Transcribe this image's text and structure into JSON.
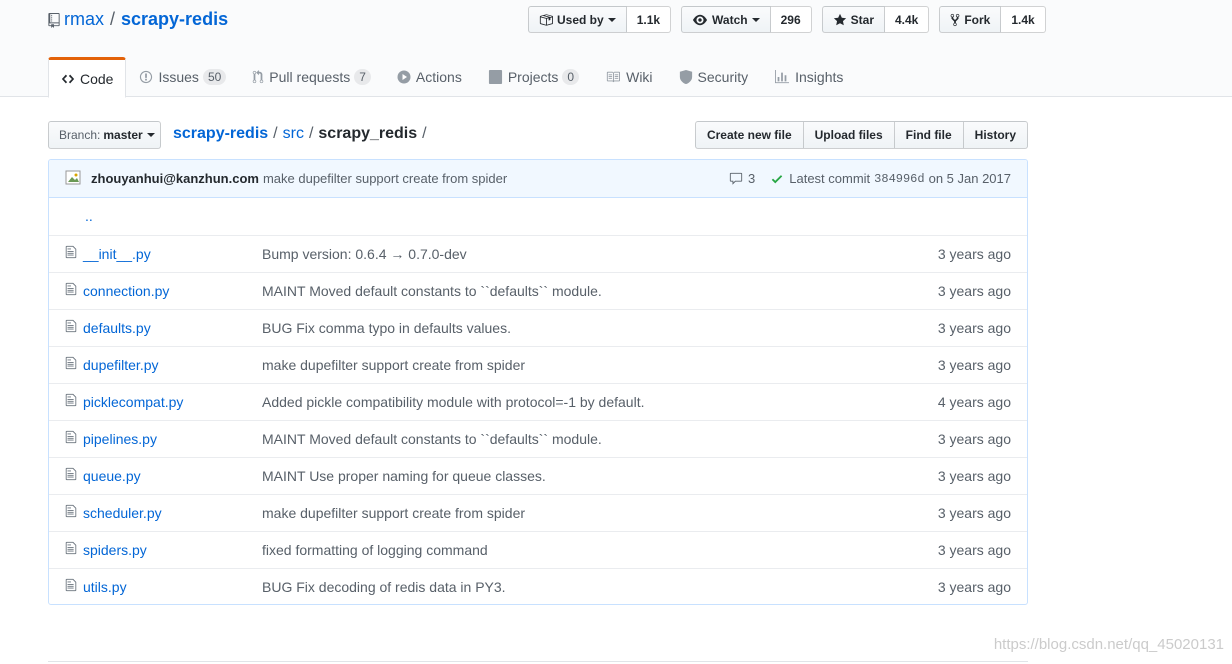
{
  "repo": {
    "owner": "rmax",
    "separator": "/",
    "name": "scrapy-redis"
  },
  "actions": [
    {
      "label": "Used by",
      "count": "1.1k",
      "icon": "package-icon",
      "dropdown": true
    },
    {
      "label": "Watch",
      "count": "296",
      "icon": "eye-icon",
      "dropdown": true
    },
    {
      "label": "Star",
      "count": "4.4k",
      "icon": "star-icon",
      "dropdown": false
    },
    {
      "label": "Fork",
      "count": "1.4k",
      "icon": "fork-icon",
      "dropdown": false
    }
  ],
  "tabs": [
    {
      "label": "Code",
      "counter": "",
      "icon": "code-icon",
      "selected": true
    },
    {
      "label": "Issues",
      "counter": "50",
      "icon": "issue-icon"
    },
    {
      "label": "Pull requests",
      "counter": "7",
      "icon": "pull-request-icon"
    },
    {
      "label": "Actions",
      "counter": "",
      "icon": "play-icon"
    },
    {
      "label": "Projects",
      "counter": "0",
      "icon": "project-icon"
    },
    {
      "label": "Wiki",
      "counter": "",
      "icon": "book-icon"
    },
    {
      "label": "Security",
      "counter": "",
      "icon": "shield-icon"
    },
    {
      "label": "Insights",
      "counter": "",
      "icon": "graph-icon"
    }
  ],
  "branch": {
    "label": "Branch:",
    "value": "master"
  },
  "breadcrumb": {
    "repo": "scrapy-redis",
    "dir": "src",
    "final": "scrapy_redis",
    "sep": "/"
  },
  "file_buttons": {
    "create": "Create new file",
    "upload": "Upload files",
    "find": "Find file",
    "history": "History"
  },
  "commit": {
    "author": "zhouyanhui@kanzhun.com",
    "message": "make dupefilter support create from spider",
    "comments": "3",
    "latest_label": "Latest commit",
    "sha": "384996d",
    "date": "on 5 Jan 2017"
  },
  "updir": "..",
  "files": [
    {
      "name": "__init__.py",
      "message": "Bump version: 0.6.4 → 0.7.0-dev",
      "age": "3 years ago"
    },
    {
      "name": "connection.py",
      "message": "MAINT Moved default constants to ``defaults`` module.",
      "age": "3 years ago"
    },
    {
      "name": "defaults.py",
      "message": "BUG Fix comma typo in defaults values.",
      "age": "3 years ago"
    },
    {
      "name": "dupefilter.py",
      "message": "make dupefilter support create from spider",
      "age": "3 years ago"
    },
    {
      "name": "picklecompat.py",
      "message": "Added pickle compatibility module with protocol=-1 by default.",
      "age": "4 years ago"
    },
    {
      "name": "pipelines.py",
      "message": "MAINT Moved default constants to ``defaults`` module.",
      "age": "3 years ago"
    },
    {
      "name": "queue.py",
      "message": "MAINT Use proper naming for queue classes.",
      "age": "3 years ago"
    },
    {
      "name": "scheduler.py",
      "message": "make dupefilter support create from spider",
      "age": "3 years ago"
    },
    {
      "name": "spiders.py",
      "message": "fixed formatting of logging command",
      "age": "3 years ago"
    },
    {
      "name": "utils.py",
      "message": "BUG Fix decoding of redis data in PY3.",
      "age": "3 years ago"
    }
  ],
  "watermark": "https://blog.csdn.net/qq_45020131",
  "colors": {
    "link": "#0366d6",
    "tab_accent": "#e36209",
    "commit_bg": "#f1f8ff",
    "check": "#28a745"
  }
}
